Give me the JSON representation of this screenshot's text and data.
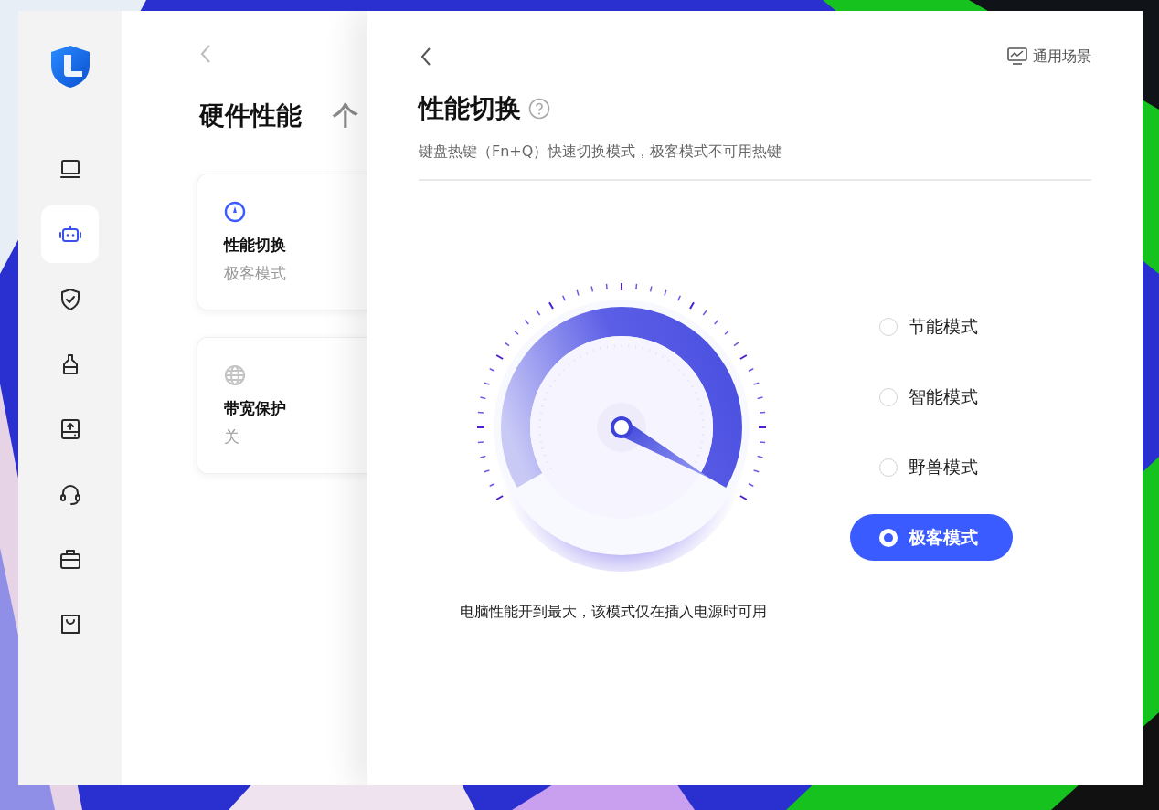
{
  "sidebar": {
    "items": [
      {
        "kind": "laptop",
        "selected": false
      },
      {
        "kind": "robot",
        "selected": true
      },
      {
        "kind": "shield",
        "selected": false
      },
      {
        "kind": "brush",
        "selected": false
      },
      {
        "kind": "drive",
        "selected": false
      },
      {
        "kind": "headset",
        "selected": false
      },
      {
        "kind": "briefcase",
        "selected": false
      },
      {
        "kind": "bag",
        "selected": false
      }
    ]
  },
  "overview": {
    "tabs": [
      {
        "label": "硬件性能",
        "selected": true
      },
      {
        "label": "个",
        "selected": false
      }
    ],
    "cards": [
      {
        "kind": "gauge",
        "title": "性能切换",
        "value": "极客模式"
      },
      {
        "kind": "globe",
        "title": "带宽保护",
        "value": "关"
      }
    ]
  },
  "detail": {
    "scene_link": "通用场景",
    "title": "性能切换",
    "subtitle": "键盘热键（Fn+Q）快速切换模式，极客模式不可用热键",
    "modes": [
      {
        "label": "节能模式",
        "selected": false
      },
      {
        "label": "智能模式",
        "selected": false
      },
      {
        "label": "野兽模式",
        "selected": false
      },
      {
        "label": "极客模式",
        "selected": true
      }
    ],
    "note": "电脑性能开到最大，该模式仅在插入电源时可用"
  }
}
